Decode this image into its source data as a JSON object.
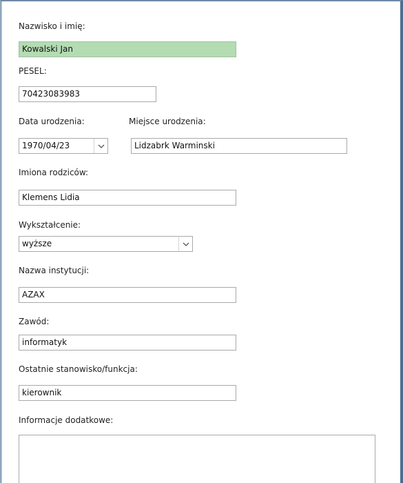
{
  "form": {
    "surname_label": "Nazwisko i imię:",
    "surname_value": "Kowalski Jan",
    "pesel_label": "PESEL:",
    "pesel_value": "70423083983",
    "birth_date_label": "Data urodzenia:",
    "birth_date_value": "1970/04/23",
    "birth_place_label": "Miejsce urodzenia:",
    "birth_place_value": "Lidzabrk Warminski",
    "parents_label": "Imiona rodziców:",
    "parents_value": "Klemens Lidia",
    "education_label": "Wykształcenie:",
    "education_value": "wyższe",
    "institution_label": "Nazwa instytucji:",
    "institution_value": "AZAX",
    "profession_label": "Zawód:",
    "profession_value": "informatyk",
    "position_label": "Ostatnie stanowisko/funkcja:",
    "position_value": "kierownik",
    "additional_label": "Informacje dodatkowe:",
    "additional_value": ""
  },
  "icons": {
    "dropdown": "chevron-down-icon"
  },
  "colors": {
    "highlight_field": "#b4dcb3",
    "frame_border": "#4f6d91"
  }
}
